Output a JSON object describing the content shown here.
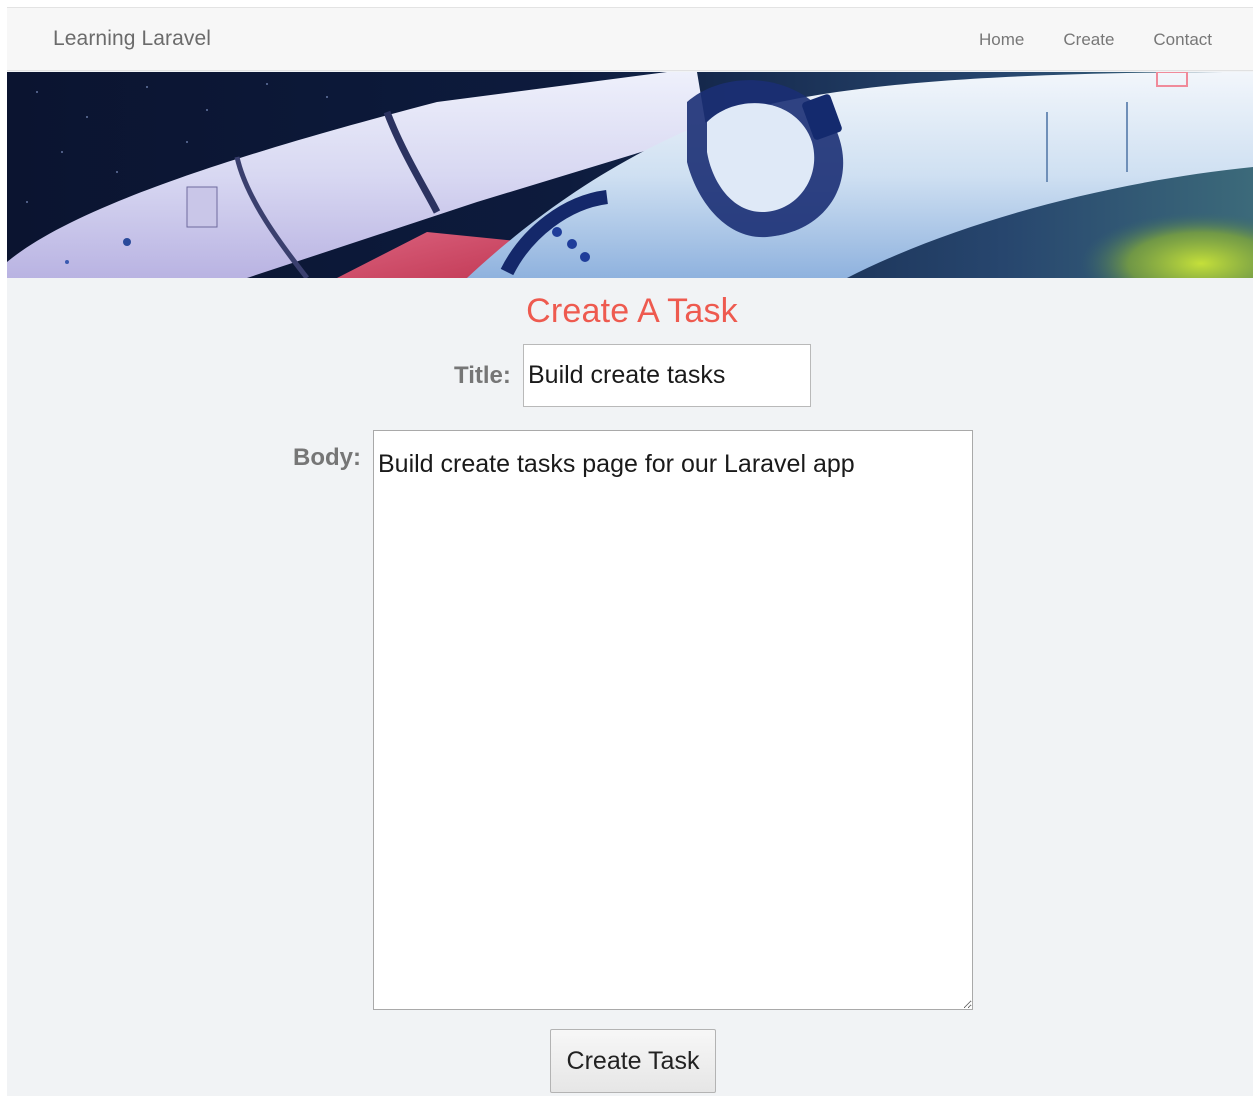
{
  "navbar": {
    "brand": "Learning Laravel",
    "links": [
      {
        "label": "Home"
      },
      {
        "label": "Create"
      },
      {
        "label": "Contact"
      }
    ]
  },
  "hero": {
    "image": "space-shuttle-rocket-banner"
  },
  "form": {
    "heading": "Create A Task",
    "title_label": "Title:",
    "title_value": "Build create tasks",
    "body_label": "Body:",
    "body_value": "Build create tasks page for our Laravel app",
    "submit_label": "Create Task"
  },
  "colors": {
    "heading": "#ee5a4f",
    "page_background": "#f1f3f5",
    "navbar_background": "#f7f7f7"
  }
}
